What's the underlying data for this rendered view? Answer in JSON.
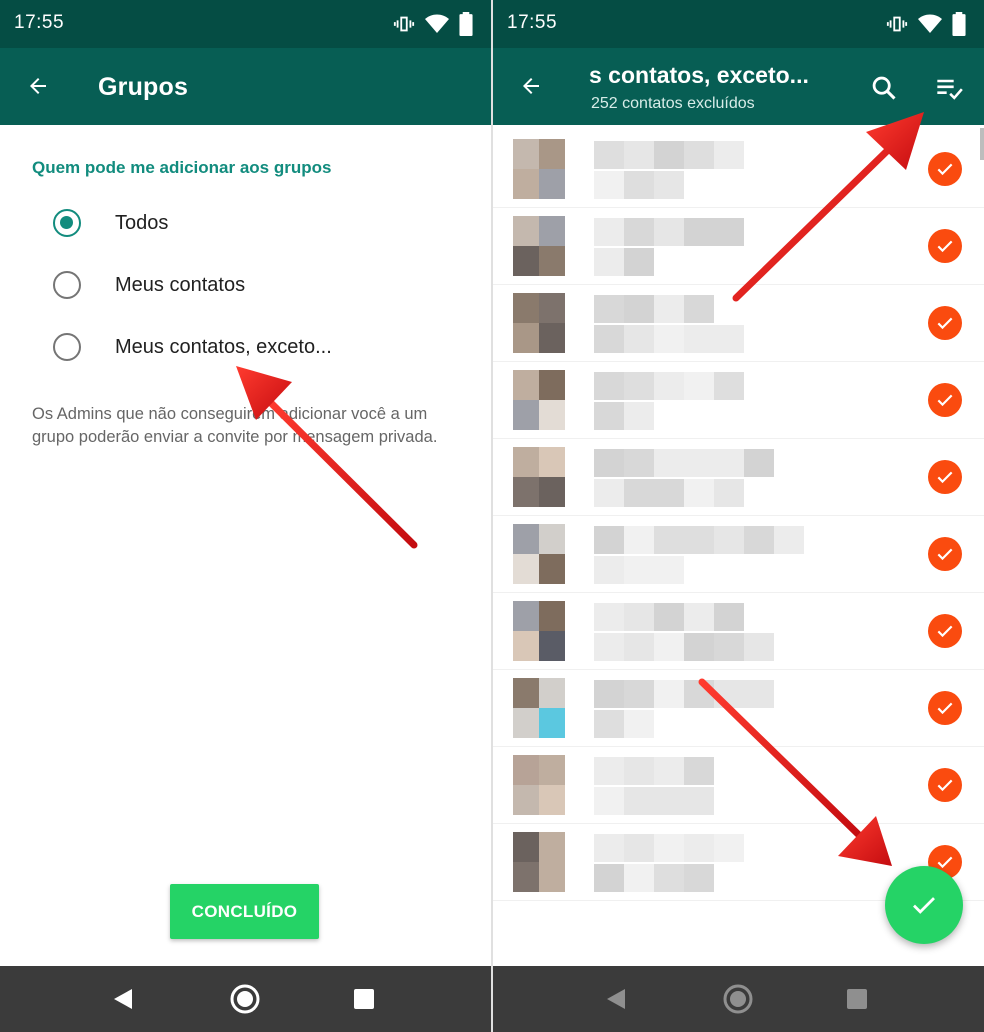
{
  "status_bar": {
    "time": "17:55"
  },
  "left_screen": {
    "title": "Grupos",
    "section_label": "Quem pode me adicionar aos grupos",
    "options": [
      {
        "label": "Todos",
        "selected": true
      },
      {
        "label": "Meus contatos",
        "selected": false
      },
      {
        "label": "Meus contatos, exceto...",
        "selected": false
      }
    ],
    "help_text": "Os Admins que não conseguirem adicionar você a um grupo poderão enviar a convite por mensagem privada.",
    "done_button": "CONCLUÍDO"
  },
  "right_screen": {
    "title": "s contatos, exceto...",
    "subtitle": "252 contatos excluídos",
    "contacts_all_selected": true,
    "selected_visible_rows": 10
  },
  "colors": {
    "status_bar": "#054d44",
    "app_bar": "#075e54",
    "accent": "#128c7e",
    "button_green": "#25d366",
    "check_orange": "#fa4b0f",
    "annotation_arrow": "#e8141b",
    "nav_bar": "#3b3b3b"
  },
  "icons": {
    "back": "arrow-left-icon",
    "search": "search-icon",
    "select_all": "select-all-icon",
    "check": "check-icon",
    "nav_back": "nav-back-triangle-icon",
    "nav_home": "nav-home-circle-icon",
    "nav_recents": "nav-recents-square-icon"
  }
}
